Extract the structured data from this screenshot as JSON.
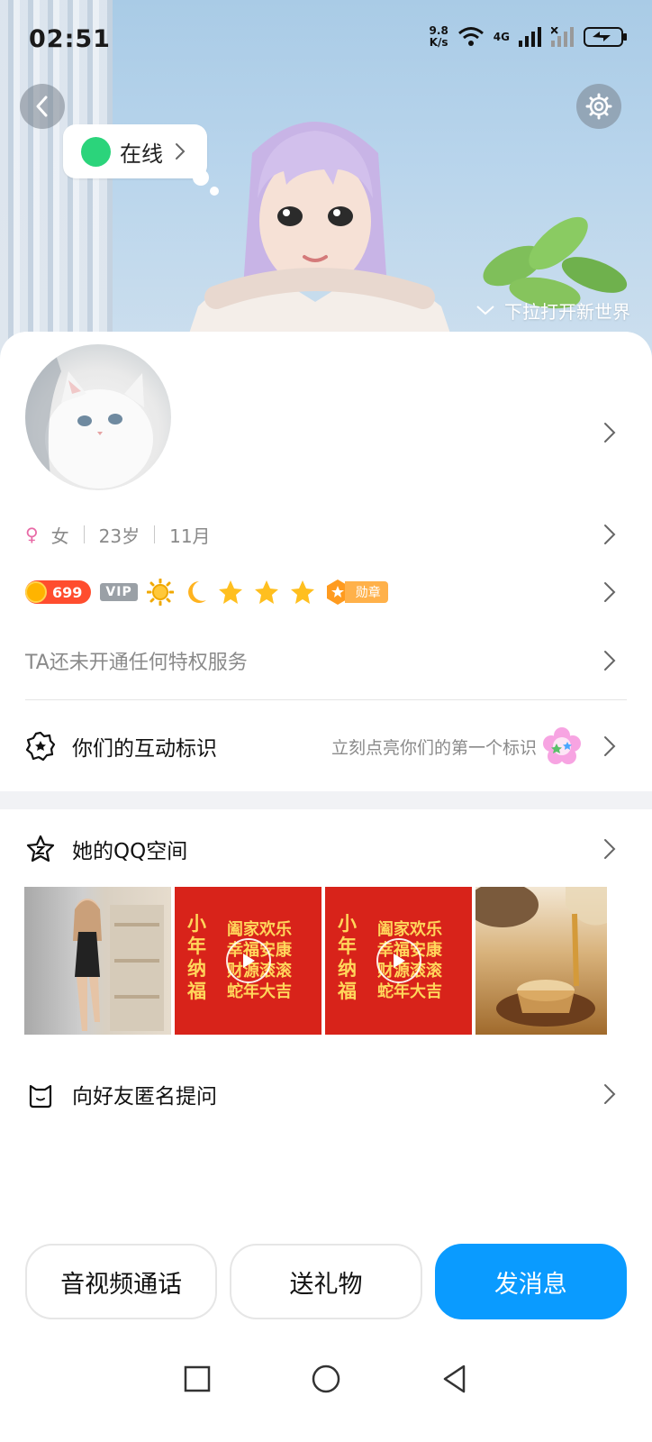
{
  "status_bar": {
    "time": "02:51",
    "net_speed_value": "9.8",
    "net_speed_unit": "K/s",
    "network": "4G"
  },
  "hero": {
    "online_status": "在线",
    "pull_hint": "下拉打开新世界"
  },
  "profile": {
    "gender": "女",
    "age": "23岁",
    "birthday": "11月",
    "coin_count": "699",
    "vip_label": "VIP",
    "medal_label": "勋章",
    "privilege_text": "TA还未开通任何特权服务"
  },
  "interaction": {
    "title": "你们的互动标识",
    "hint": "立刻点亮你们的第一个标识"
  },
  "qzone": {
    "title": "她的QQ空间",
    "photos": [
      {
        "type": "image"
      },
      {
        "type": "video",
        "lines": [
          "阖家欢乐",
          "幸福安康",
          "财源滚滚",
          "蛇年大吉"
        ],
        "side": [
          "小",
          "年",
          "纳",
          "福"
        ]
      },
      {
        "type": "video",
        "lines": [
          "阖家欢乐",
          "幸福安康",
          "财源滚滚",
          "蛇年大吉"
        ],
        "side": [
          "小",
          "年",
          "纳",
          "福"
        ]
      },
      {
        "type": "image"
      }
    ]
  },
  "ask": {
    "title": "向好友匿名提问"
  },
  "actions": {
    "call": "音视频通话",
    "gift": "送礼物",
    "message": "发消息"
  },
  "colors": {
    "accent": "#0a9bff",
    "online": "#2bd47b",
    "coin": "#ff4d2e"
  }
}
